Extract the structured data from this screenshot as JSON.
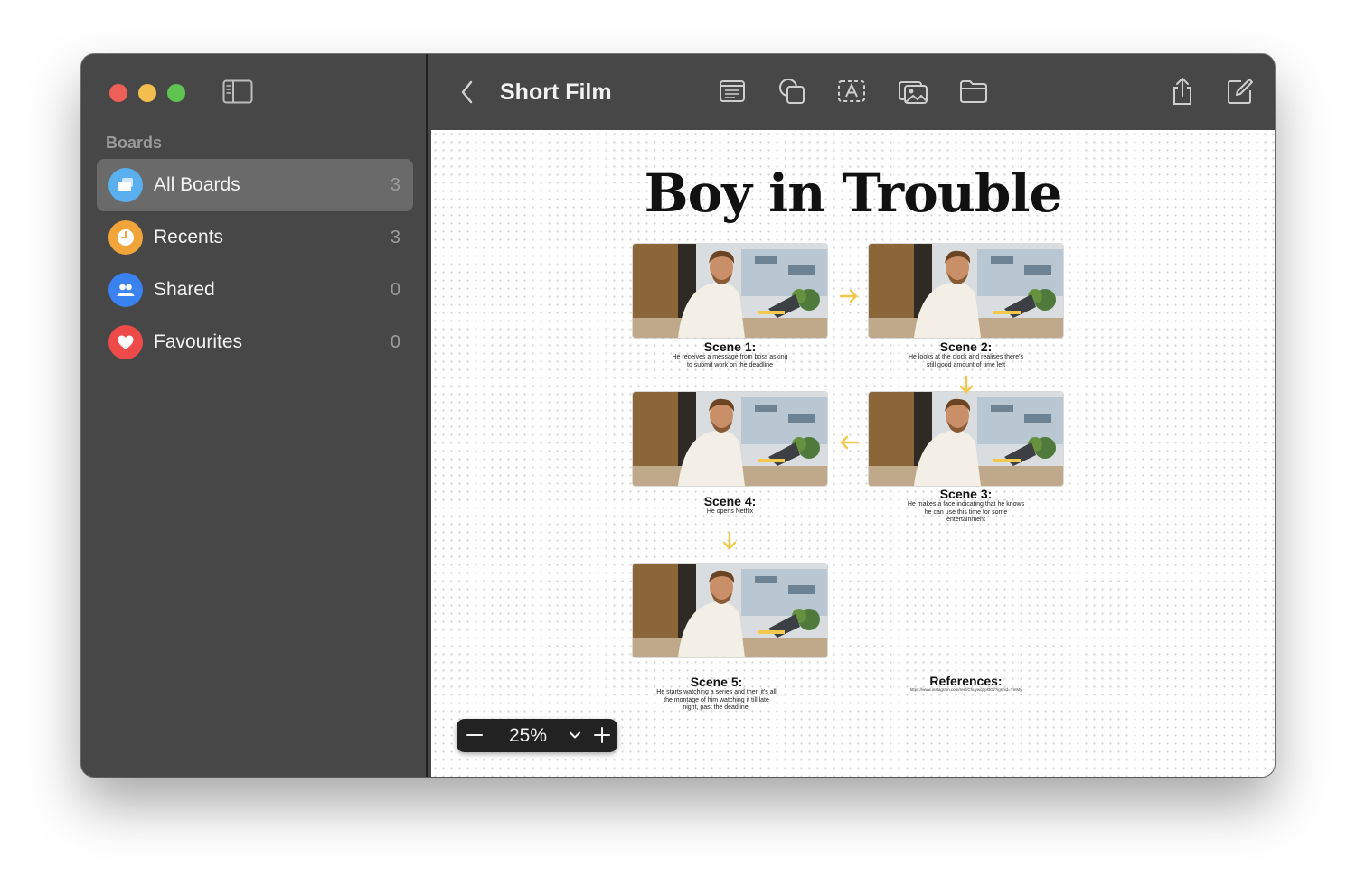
{
  "window": {
    "traffic_lights": {
      "close": "#ed5f57",
      "minimize": "#f4be4f",
      "maximize": "#5fc452"
    }
  },
  "sidebar": {
    "heading": "Boards",
    "items": [
      {
        "label": "All Boards",
        "count": "3",
        "icon": "boards-icon",
        "color": "#5ab0ee",
        "active": true
      },
      {
        "label": "Recents",
        "count": "3",
        "icon": "clock-icon",
        "color": "#f0a43a",
        "active": false
      },
      {
        "label": "Shared",
        "count": "0",
        "icon": "people-icon",
        "color": "#3a82f0",
        "active": false
      },
      {
        "label": "Favourites",
        "count": "0",
        "icon": "heart-icon",
        "color": "#ee4a4a",
        "active": false
      }
    ]
  },
  "toolbar": {
    "title": "Short Film",
    "icons": [
      "back-chevron-icon",
      "text-box-icon",
      "shapes-icon",
      "text-tool-icon",
      "media-icon",
      "folder-icon",
      "share-icon",
      "compose-icon"
    ]
  },
  "board": {
    "title": "Boy in Trouble",
    "scenes": [
      {
        "title": "Scene 1:",
        "desc": "He receives a message from boss asking to submit work on the deadline"
      },
      {
        "title": "Scene 2:",
        "desc": "He looks at the clock and realises there's still good amount of time left"
      },
      {
        "title": "Scene 3:",
        "desc": "He makes a face indicating that he knows he can use this time for some entertainment"
      },
      {
        "title": "Scene 4:",
        "desc": "He opens Netflix"
      },
      {
        "title": "Scene 5:",
        "desc": "He starts watching a series and then it's all the montage of him watching it till late night, past the deadline."
      }
    ],
    "references": {
      "title": "References:",
      "url": "https://www.instagram.com/reel/Chuywq7pODl/?igshid=YmMy"
    },
    "arrow_color": "#f2c94c"
  },
  "zoom": {
    "value": "25%"
  }
}
